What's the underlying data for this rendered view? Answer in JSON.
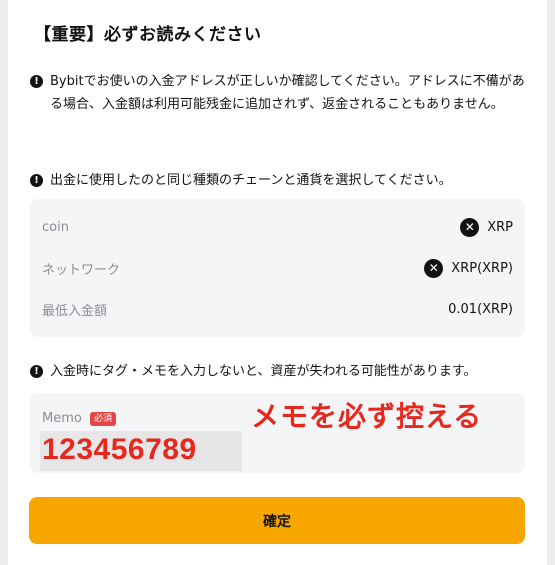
{
  "title": "【重要】必ずお読みください",
  "notices": [
    "Bybitでお使いの入金アドレスが正しいか確認してください。アドレスに不備がある場合、入金額は利用可能残金に追加されず、返金されることもありません。",
    "出金に使用したのと同じ種類のチェーンと通貨を選択してください。",
    "入金時にタグ・メモを入力しないと、資産が失われる可能性があります。"
  ],
  "warn_glyph": "!",
  "info": {
    "coin_label": "coin",
    "coin_value": "XRP",
    "network_label": "ネットワーク",
    "network_value": "XRP(XRP)",
    "min_label": "最低入金額",
    "min_value": "0.01(XRP)",
    "icon_glyph": "✕",
    "icon_name": "xrp-icon"
  },
  "memo": {
    "label": "Memo",
    "required_badge": "必須",
    "value": "123456789",
    "annotation": "メモを必ず控える"
  },
  "confirm_label": "確定",
  "colors": {
    "accent": "#f7a600",
    "annotation_red": "#e8271f",
    "badge_red": "#e54545",
    "panel_bg": "#f4f5f7"
  }
}
